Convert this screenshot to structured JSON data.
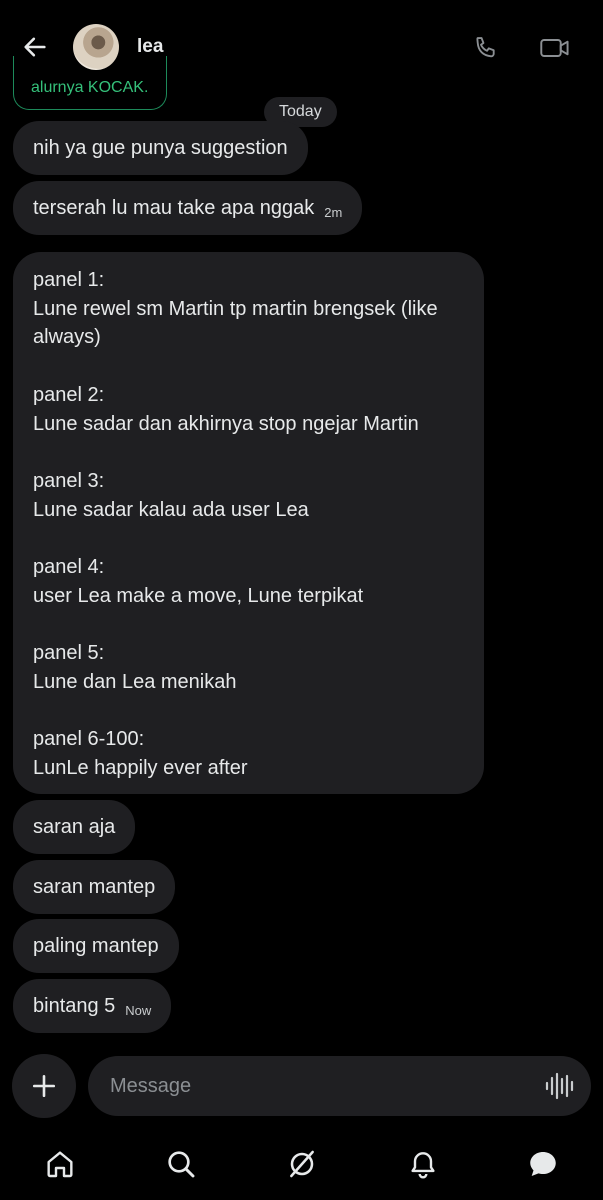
{
  "header": {
    "contact_name": "lea",
    "icons": [
      "back-arrow-icon",
      "phone-icon",
      "video-camera-icon"
    ]
  },
  "previous_message": {
    "text": "alurnya KOCAK."
  },
  "date_separator": "Today",
  "messages": [
    {
      "text": "nih ya gue punya suggestion",
      "time": ""
    },
    {
      "text": "terserah lu mau take apa nggak",
      "time": "2m"
    },
    {
      "lines": [
        "panel 1:",
        "Lune rewel sm Martin tp martin brengsek (like",
        "always)",
        "",
        "panel 2:",
        "Lune sadar dan akhirnya stop ngejar Martin",
        "",
        "panel 3:",
        "Lune sadar kalau ada user Lea",
        "",
        "panel 4:",
        "user Lea make a move, Lune terpikat",
        "",
        "panel 5:",
        "Lune dan Lea menikah",
        "",
        "panel 6-100:",
        "LunLe happily ever after"
      ]
    },
    {
      "text": "saran aja",
      "time": ""
    },
    {
      "text": "saran mantep",
      "time": ""
    },
    {
      "text": "paling mantep",
      "time": ""
    },
    {
      "text": "bintang 5",
      "time": "Now"
    }
  ],
  "composer": {
    "placeholder": "Message",
    "icons": [
      "plus-icon",
      "voice-wave-icon"
    ]
  },
  "bottom_nav": {
    "items": [
      "home-icon",
      "search-icon",
      "grok-icon",
      "notifications-icon",
      "messages-icon"
    ]
  },
  "colors": {
    "background": "#000000",
    "bubble": "#1f1f22",
    "text": "#e7e9ea",
    "accent_green": "#35c07a"
  }
}
